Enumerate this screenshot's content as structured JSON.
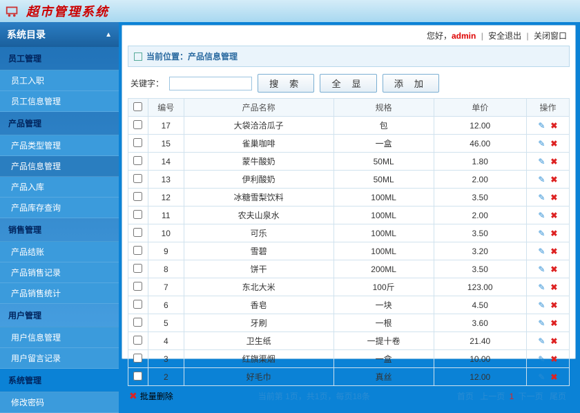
{
  "app_title": "超市管理系统",
  "sidebar": {
    "title": "系统目录",
    "sections": [
      {
        "header": "员工管理",
        "items": [
          "员工入职",
          "员工信息管理"
        ]
      },
      {
        "header": "产品管理",
        "items": [
          "产品类型管理",
          "产品信息管理",
          "产品入库",
          "产品库存查询"
        ],
        "active_index": 1
      },
      {
        "header": "销售管理",
        "items": [
          "产品结账",
          "产品销售记录",
          "产品销售统计"
        ]
      },
      {
        "header": "用户管理",
        "items": [
          "用户信息管理",
          "用户留言记录"
        ]
      },
      {
        "header": "系统管理",
        "items": [
          "修改密码"
        ]
      }
    ]
  },
  "topbar": {
    "greeting": "您好，",
    "user": "admin",
    "logout": "安全退出",
    "close": "关闭窗口"
  },
  "breadcrumb": "当前位置：产品信息管理",
  "toolbar": {
    "kw_label": "关键字：",
    "search": "搜 索",
    "showall": "全 显",
    "add": "添 加"
  },
  "table": {
    "headers": {
      "id": "编号",
      "name": "产品名称",
      "spec": "规格",
      "price": "单价",
      "ops": "操作"
    },
    "rows": [
      {
        "id": "17",
        "name": "大袋洽洽瓜子",
        "spec": "包",
        "price": "12.00"
      },
      {
        "id": "15",
        "name": "雀巢咖啡",
        "spec": "一盒",
        "price": "46.00"
      },
      {
        "id": "14",
        "name": "蒙牛酸奶",
        "spec": "50ML",
        "price": "1.80"
      },
      {
        "id": "13",
        "name": "伊利酸奶",
        "spec": "50ML",
        "price": "2.00"
      },
      {
        "id": "12",
        "name": "冰糖雪梨饮料",
        "spec": "100ML",
        "price": "3.50"
      },
      {
        "id": "11",
        "name": "农夫山泉水",
        "spec": "100ML",
        "price": "2.00"
      },
      {
        "id": "10",
        "name": "可乐",
        "spec": "100ML",
        "price": "3.50"
      },
      {
        "id": "9",
        "name": "雪碧",
        "spec": "100ML",
        "price": "3.20"
      },
      {
        "id": "8",
        "name": "饼干",
        "spec": "200ML",
        "price": "3.50"
      },
      {
        "id": "7",
        "name": "东北大米",
        "spec": "100斤",
        "price": "123.00"
      },
      {
        "id": "6",
        "name": "香皂",
        "spec": "一块",
        "price": "4.50"
      },
      {
        "id": "5",
        "name": "牙刷",
        "spec": "一根",
        "price": "3.60"
      },
      {
        "id": "4",
        "name": "卫生纸",
        "spec": "一提十卷",
        "price": "21.40"
      },
      {
        "id": "3",
        "name": "红旗渠烟",
        "spec": "一盒",
        "price": "10.00"
      },
      {
        "id": "2",
        "name": "好毛巾",
        "spec": "真丝",
        "price": "12.00"
      }
    ]
  },
  "footer": {
    "batch_delete": "批量删除",
    "pageinfo": "当前第 1页，共1页，每页18条",
    "nav": {
      "first": "首页",
      "prev": "上一页",
      "page": "1",
      "next": "下一页",
      "last": "尾页"
    }
  }
}
